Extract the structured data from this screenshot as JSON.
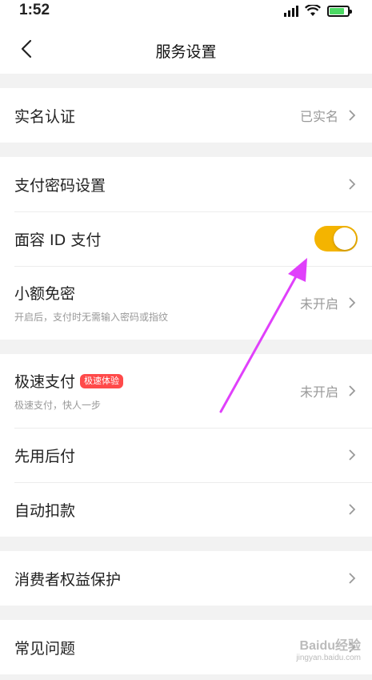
{
  "status_bar": {
    "time": "1:52"
  },
  "nav": {
    "title": "服务设置",
    "back_icon": "chevron-left-icon"
  },
  "sections": [
    {
      "rows": [
        {
          "title": "实名认证",
          "value": "已实名"
        }
      ]
    },
    {
      "rows": [
        {
          "title": "支付密码设置"
        },
        {
          "title": "面容 ID 支付",
          "toggle_on": true,
          "toggle_color": "#f4b400"
        },
        {
          "title": "小额免密",
          "subtitle": "开启后，支付时无需输入密码或指纹",
          "value": "未开启"
        }
      ]
    },
    {
      "rows": [
        {
          "title": "极速支付",
          "badge": "极速体验",
          "subtitle": "极速支付，快人一步",
          "value": "未开启"
        },
        {
          "title": "先用后付"
        },
        {
          "title": "自动扣款"
        }
      ]
    },
    {
      "rows": [
        {
          "title": "消费者权益保护"
        }
      ]
    },
    {
      "rows": [
        {
          "title": "常见问题"
        }
      ]
    }
  ],
  "annotation": {
    "arrow_color": "#e040fb"
  },
  "watermark": {
    "brand": "Baidu经验",
    "url": "jingyan.baidu.com"
  }
}
